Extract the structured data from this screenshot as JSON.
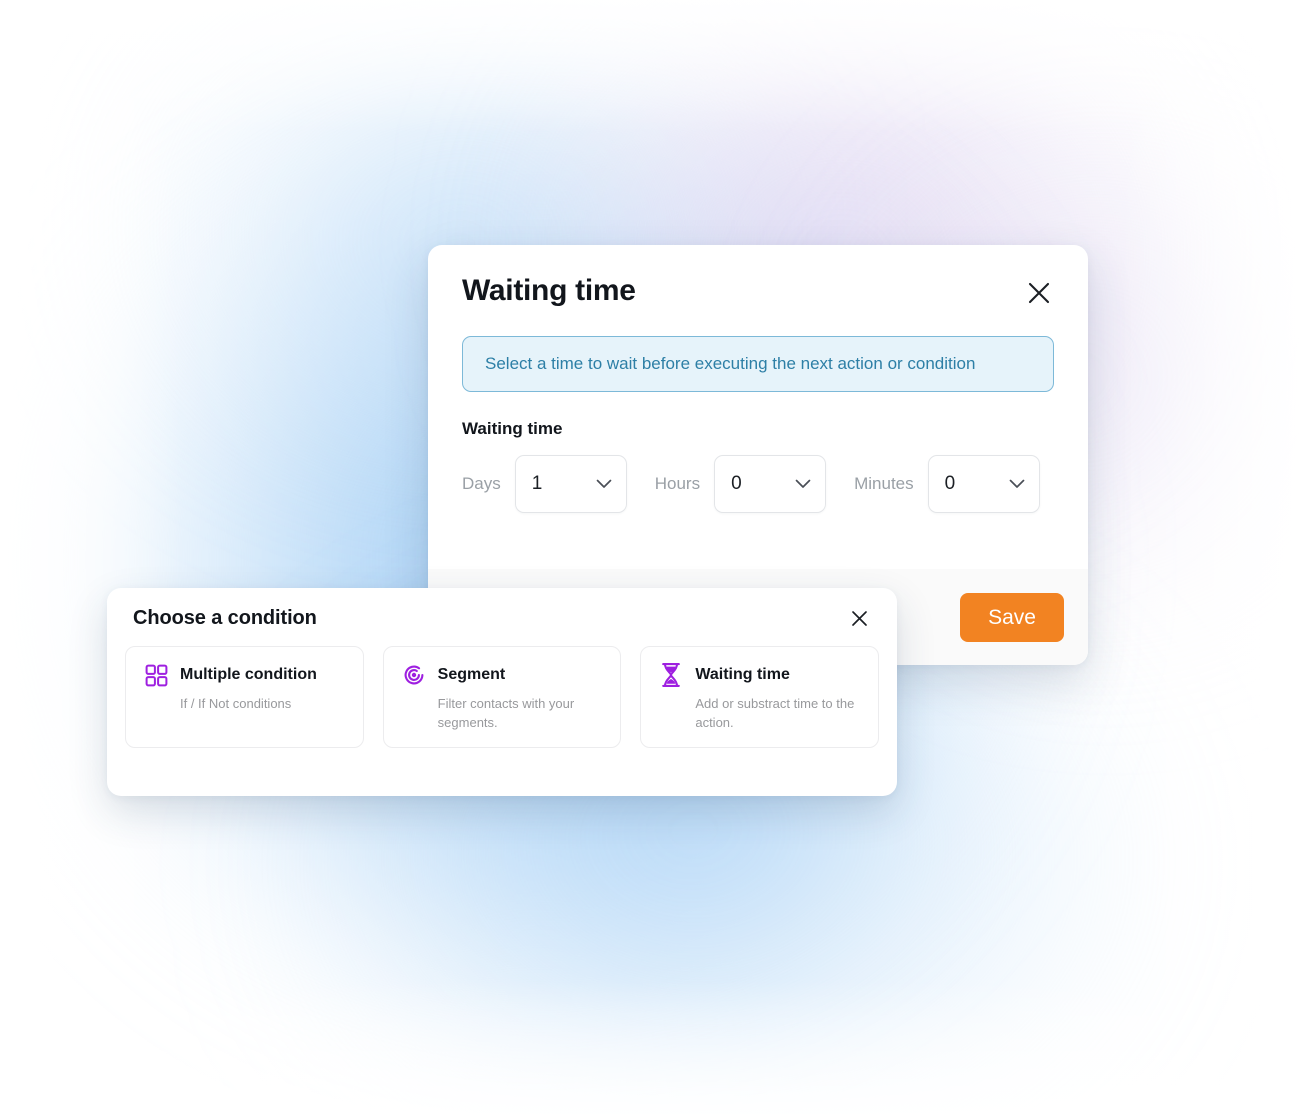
{
  "background": {
    "accent_blue": "#96c7f3",
    "accent_violet": "#d1c4ec"
  },
  "waiting_modal": {
    "title": "Waiting time",
    "close_icon": "close-icon",
    "info_banner": "Select a time to wait before executing the next action or condition",
    "field_label": "Waiting time",
    "units": [
      {
        "label": "Days",
        "value": "1",
        "chevron_icon": "chevron-down-icon"
      },
      {
        "label": "Hours",
        "value": "0",
        "chevron_icon": "chevron-down-icon"
      },
      {
        "label": "Minutes",
        "value": "0",
        "chevron_icon": "chevron-down-icon"
      }
    ],
    "save_label": "Save",
    "save_color": "#f28322"
  },
  "condition_panel": {
    "title": "Choose a condition",
    "close_icon": "close-icon",
    "icon_color": "#9e1fe0",
    "cards": [
      {
        "icon": "grid-2x2-icon",
        "title": "Multiple condition",
        "description": "If / If Not conditions"
      },
      {
        "icon": "segment-spiral-icon",
        "title": "Segment",
        "description": "Filter contacts with your segments."
      },
      {
        "icon": "hourglass-icon",
        "title": "Waiting time",
        "description": "Add or substract time to the action."
      }
    ]
  }
}
